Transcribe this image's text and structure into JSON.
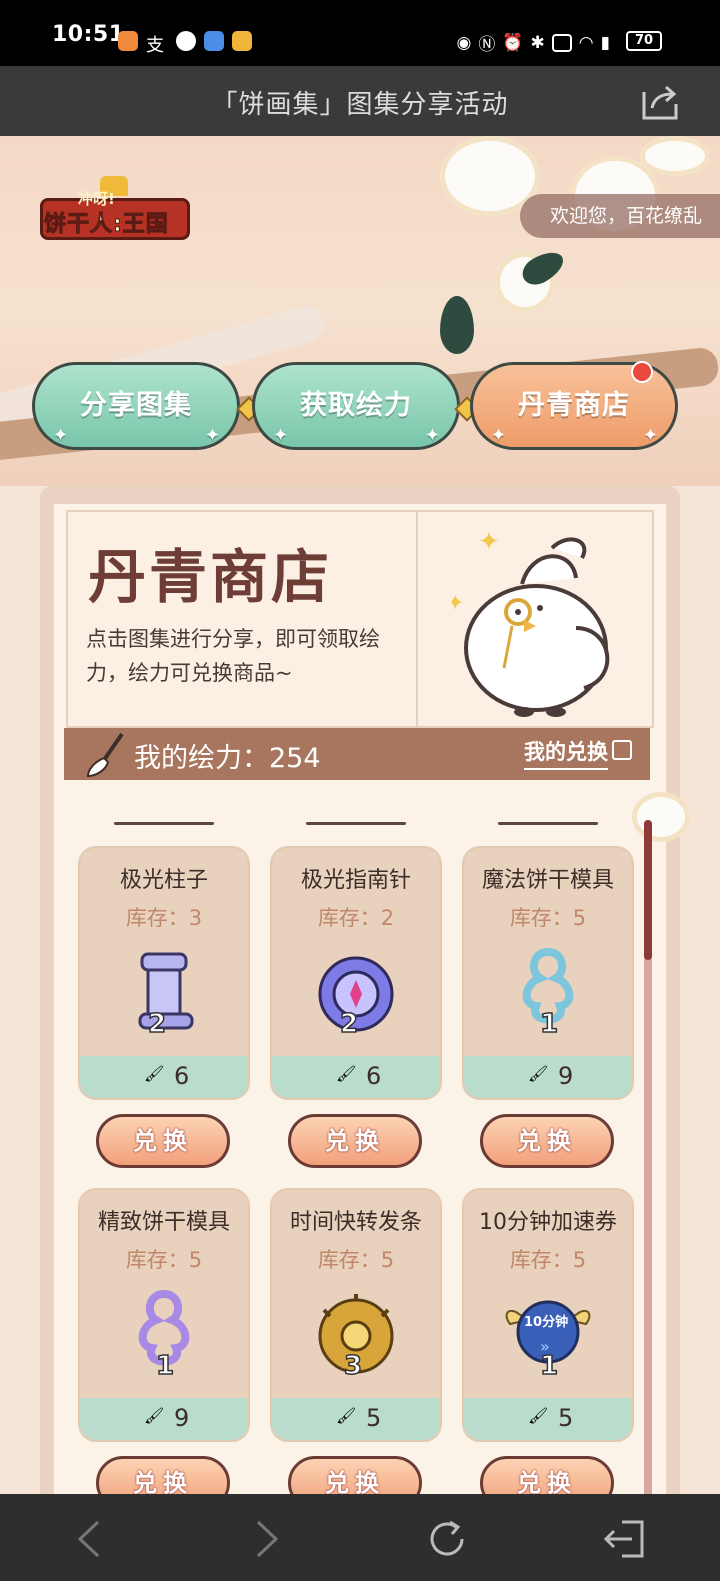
{
  "status_bar": {
    "time": "10:51",
    "battery": "70"
  },
  "title_bar": {
    "title": "「饼画集」图集分享活动"
  },
  "hero": {
    "logo_top": "冲呀!",
    "logo_main": "饼干人:王国",
    "welcome": "欢迎您，百花缭乱"
  },
  "tabs": [
    {
      "label": "分享图集",
      "active": false
    },
    {
      "label": "获取绘力",
      "active": false
    },
    {
      "label": "丹青商店",
      "active": true
    }
  ],
  "shop": {
    "title": "丹青商店",
    "description": "点击图集进行分享，即可领取绘力，绘力可兑换商品~",
    "my_power_label": "我的绘力：254",
    "my_exchange": "我的兑换"
  },
  "items": [
    {
      "name": "极光柱子",
      "stock": "库存：3",
      "count": "2",
      "price": "6",
      "redeem": "兑换",
      "icon": "aurora-pillar-icon"
    },
    {
      "name": "极光指南针",
      "stock": "库存：2",
      "count": "2",
      "price": "6",
      "redeem": "兑换",
      "icon": "aurora-compass-icon"
    },
    {
      "name": "魔法饼干模具",
      "stock": "库存：5",
      "count": "1",
      "price": "9",
      "redeem": "兑换",
      "icon": "magic-cookie-cutter-icon"
    },
    {
      "name": "精致饼干模具",
      "stock": "库存：5",
      "count": "1",
      "price": "9",
      "redeem": "兑换",
      "icon": "fine-cookie-cutter-icon"
    },
    {
      "name": "时间快转发条",
      "stock": "库存：5",
      "count": "3",
      "price": "5",
      "redeem": "兑换",
      "icon": "time-spring-icon"
    },
    {
      "name": "10分钟加速券",
      "stock": "库存：5",
      "count": "1",
      "price": "5",
      "redeem": "兑换",
      "icon": "speedup-ticket-icon",
      "ticket_text": "10分钟"
    }
  ],
  "colors": {
    "tab_green": "#79c6aa",
    "tab_orange": "#ee9c6a",
    "bar_brown": "#a8765e",
    "price_green": "#b9dccd"
  }
}
